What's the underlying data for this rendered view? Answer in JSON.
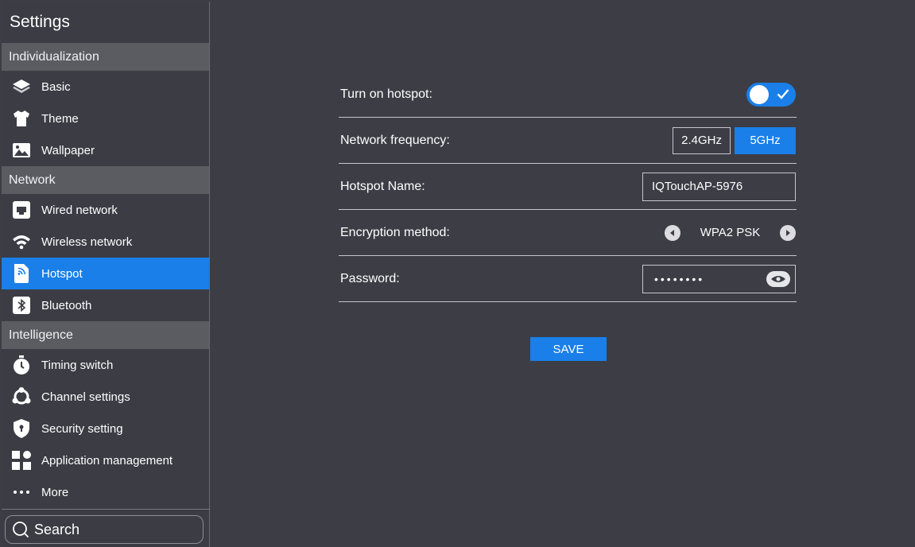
{
  "sidebar": {
    "title": "Settings",
    "sections": [
      {
        "label": "Individualization",
        "items": [
          {
            "label": "Basic",
            "icon": "layers-icon"
          },
          {
            "label": "Theme",
            "icon": "tshirt-icon"
          },
          {
            "label": "Wallpaper",
            "icon": "picture-icon"
          }
        ]
      },
      {
        "label": "Network",
        "items": [
          {
            "label": "Wired network",
            "icon": "ethernet-icon"
          },
          {
            "label": "Wireless network",
            "icon": "wifi-icon"
          },
          {
            "label": "Hotspot",
            "icon": "hotspot-icon",
            "active": true
          },
          {
            "label": "Bluetooth",
            "icon": "bluetooth-icon"
          }
        ]
      },
      {
        "label": "Intelligence",
        "items": [
          {
            "label": "Timing switch",
            "icon": "stopwatch-icon"
          },
          {
            "label": "Channel settings",
            "icon": "channels-icon"
          },
          {
            "label": "Security setting",
            "icon": "shield-icon"
          },
          {
            "label": "Application management",
            "icon": "apps-icon"
          },
          {
            "label": "More",
            "icon": "more-dots-icon"
          }
        ]
      }
    ],
    "search_placeholder": "Search"
  },
  "hotspot": {
    "turn_on_label": "Turn on hotspot:",
    "turn_on_state": true,
    "frequency_label": "Network frequency:",
    "frequency_options": [
      "2.4GHz",
      "5GHz"
    ],
    "frequency_selected": "5GHz",
    "name_label": "Hotspot Name:",
    "name_value": "IQTouchAP-5976",
    "encryption_label": "Encryption method:",
    "encryption_value": "WPA2 PSK",
    "password_label": "Password:",
    "password_mask": "••••••••",
    "save_label": "SAVE"
  },
  "colors": {
    "accent": "#1a7fe8",
    "background": "#3c3d45",
    "section_header": "#5b5c62"
  }
}
